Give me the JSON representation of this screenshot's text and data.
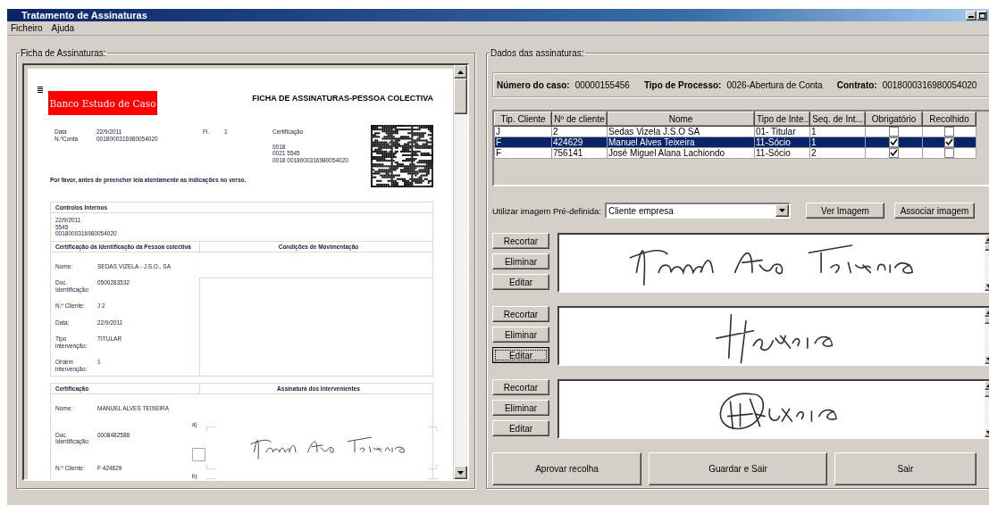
{
  "window": {
    "title": "Tratamento de Assinaturas"
  },
  "menu": [
    "Ficheiro",
    "Ajuda"
  ],
  "left_panel": {
    "legend": "Ficha de Assinaturas:",
    "document": {
      "bank_name": "Banco Estudo de Caso",
      "title": "FICHA DE ASSINATURAS-PESSOA COLECTIVA",
      "header_fields": [
        {
          "label": "Data",
          "value": "22/9/2011"
        },
        {
          "label": "N.ºConta",
          "value": "0018000316980054020"
        }
      ],
      "sheet": {
        "label": "Fl.",
        "value": "1"
      },
      "certification": {
        "label": "Certificação",
        "lines": [
          "0018",
          "0021 5545",
          "0018 0018000316980054020"
        ]
      },
      "notice": "Por favor, antes de preencher leia atentamente as indicações no verso.",
      "internal_controls": {
        "heading": "Controlos Internos",
        "lines": [
          "22/9/2011",
          "5545",
          "0018000316980054020"
        ]
      },
      "entity_section": {
        "heading_left": "Certificação da Identificação da Pessoa colectiva",
        "heading_right": "Condições de Movimentação",
        "fields": [
          {
            "label": "Nome:",
            "value": "SEDAS VIZELA - J.S.O., SA"
          },
          {
            "label": "Doc. Identificação:",
            "value": "0500283532"
          },
          {
            "label": "N.º Cliente:",
            "value": "J 2"
          },
          {
            "label": "Data:",
            "value": "22/9/2011"
          },
          {
            "label": "Tipo intervenção:",
            "value": "TITULAR"
          },
          {
            "label": "Ordem intervenção:",
            "value": "1"
          }
        ]
      },
      "signer_section": {
        "heading_left": "Certificação",
        "heading_right": "Assinatura dos Intervenientes",
        "fields": [
          {
            "label": "Nome:",
            "value": "MANUEL ALVES TEIXEIRA"
          },
          {
            "label": "Doc. Identificação:",
            "value": "0008482588"
          },
          {
            "label": "N.º Cliente:",
            "value": "F 424629"
          }
        ],
        "slots": [
          "a)",
          "b)"
        ],
        "checkbox": {
          "checked": false
        }
      }
    }
  },
  "right_panel": {
    "legend": "Dados das assinaturas:",
    "case_info": [
      {
        "label": "Número do caso:",
        "value": "00000155456"
      },
      {
        "label": "Tipo de Processo:",
        "value": "0026-Abertura de Conta"
      },
      {
        "label": "Contrato:",
        "value": "0018000316980054020"
      }
    ],
    "table": {
      "columns": [
        "Tip. Cliente",
        "Nº de cliente",
        "Nome",
        "Tipo de Inte...",
        "Seq. de Int...",
        "Obrigatório",
        "Recolhido"
      ],
      "rows": [
        {
          "cells": [
            "J",
            "2",
            "Sedas Vizela J.S.O SA",
            "01- Titular",
            "1"
          ],
          "obrigatorio": false,
          "recolhido": false,
          "selected": false
        },
        {
          "cells": [
            "F",
            "424629",
            "Manuel Alves Teixeira",
            "11-Sócio",
            "1"
          ],
          "obrigatorio": true,
          "recolhido": true,
          "selected": true
        },
        {
          "cells": [
            "F",
            "756141",
            "José Miguel Alana Lachiondo",
            "11-Sócio",
            "2"
          ],
          "obrigatorio": true,
          "recolhido": false,
          "selected": false
        }
      ]
    },
    "predefined": {
      "label": "Utilizar imagem Pré-definida:",
      "value": "Cliente empresa"
    },
    "image_buttons": [
      "Ver Imagem",
      "Associar imagem"
    ],
    "signature_rows": [
      {
        "actions": [
          {
            "label": "Recortar",
            "focused": false
          },
          {
            "label": "Eliminar",
            "focused": false
          },
          {
            "label": "Editar",
            "focused": false
          }
        ]
      },
      {
        "actions": [
          {
            "label": "Recortar",
            "focused": false
          },
          {
            "label": "Eliminar",
            "focused": false
          },
          {
            "label": "Editar",
            "focused": true
          }
        ]
      },
      {
        "actions": [
          {
            "label": "Recortar",
            "focused": false
          },
          {
            "label": "Eliminar",
            "focused": false
          },
          {
            "label": "Editar",
            "focused": false
          }
        ]
      }
    ],
    "footer_buttons": [
      "Aprovar recolha",
      "Guardar e Sair",
      "Sair"
    ]
  }
}
